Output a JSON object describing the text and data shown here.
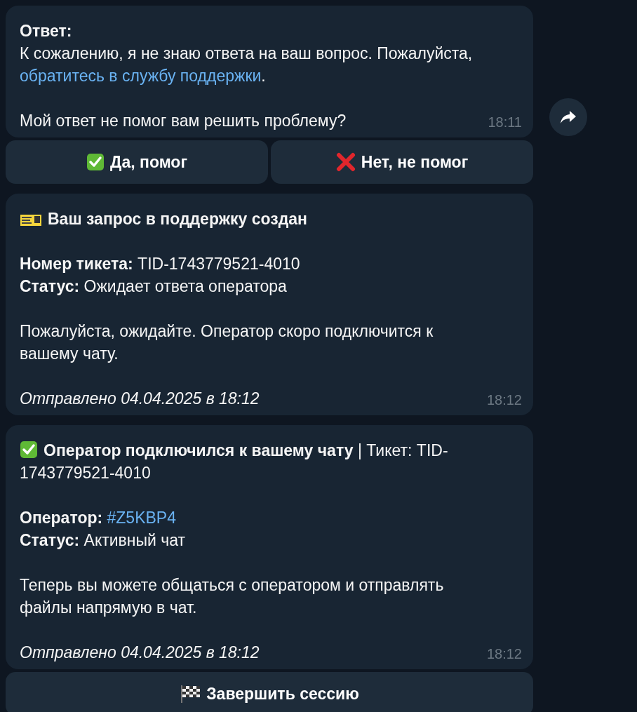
{
  "messages": [
    {
      "paragraphs": [
        [
          [
            {
              "kind": "bold",
              "text": "Ответ:"
            }
          ],
          [
            {
              "kind": "plain",
              "text": "К сожалению, я не знаю ответа на ваш вопрос. Пожалуйста, "
            },
            {
              "kind": "link",
              "text": "обратитесь в службу поддержки"
            },
            {
              "kind": "plain",
              "text": "."
            }
          ]
        ],
        [
          [
            {
              "kind": "plain",
              "text": "Мой ответ не помог вам решить проблему?"
            }
          ]
        ]
      ],
      "time": "18:11",
      "forward": true,
      "buttons": [
        [
          {
            "kind": "check",
            "label": "Да, помог"
          },
          {
            "kind": "cross",
            "label": "Нет, не помог"
          }
        ]
      ]
    },
    {
      "paragraphs": [
        [
          [
            {
              "kind": "ticket"
            },
            {
              "kind": "bold",
              "text": "Ваш запрос в поддержку создан"
            }
          ]
        ],
        [
          [
            {
              "kind": "bold",
              "text": "Номер тикета: "
            },
            {
              "kind": "plain",
              "text": "TID-1743779521-4010"
            }
          ],
          [
            {
              "kind": "bold",
              "text": "Статус: "
            },
            {
              "kind": "plain",
              "text": "Ожидает ответа оператора"
            }
          ]
        ],
        [
          [
            {
              "kind": "plain",
              "text": "Пожалуйста, ожидайте. Оператор скоро подключится к вашему чату."
            }
          ]
        ],
        [
          [
            {
              "kind": "italic",
              "text": "Отправлено 04.04.2025 в 18:12"
            }
          ]
        ]
      ],
      "time": "18:12"
    },
    {
      "paragraphs": [
        [
          [
            {
              "kind": "check"
            },
            {
              "kind": "bold",
              "text": "Оператор подключился к вашему чату"
            },
            {
              "kind": "plain",
              "text": " | Тикет: TID-1743779521-4010"
            }
          ]
        ],
        [
          [
            {
              "kind": "bold",
              "text": "Оператор: "
            },
            {
              "kind": "link",
              "text": "#Z5KBP4"
            }
          ],
          [
            {
              "kind": "bold",
              "text": "Статус: "
            },
            {
              "kind": "plain",
              "text": "Активный чат"
            }
          ]
        ],
        [
          [
            {
              "kind": "plain",
              "text": "Теперь вы можете общаться с оператором и отправлять файлы напрямую в чат."
            }
          ]
        ],
        [
          [
            {
              "kind": "italic",
              "text": "Отправлено 04.04.2025 в 18:12"
            }
          ]
        ]
      ],
      "time": "18:12",
      "buttons": [
        [
          {
            "kind": "flag",
            "label": "Завершить сессию"
          }
        ]
      ]
    }
  ]
}
